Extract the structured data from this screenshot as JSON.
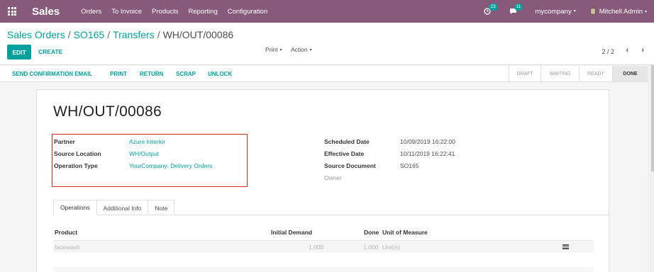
{
  "navbar": {
    "app_name": "Sales",
    "menu": [
      "Orders",
      "To Invoice",
      "Products",
      "Reporting",
      "Configuration"
    ],
    "activity_count": "23",
    "message_count": "11",
    "company": "mycompany",
    "user": "Mitchell Admin"
  },
  "breadcrumb": {
    "items": [
      "Sales Orders",
      "SO165",
      "Transfers"
    ],
    "separator": "/",
    "current": "WH/OUT/00086"
  },
  "toolbar": {
    "edit_label": "EDIT",
    "create_label": "CREATE",
    "print_label": "Print",
    "action_label": "Action",
    "pager": "2 / 2",
    "prev_glyph": "‹",
    "next_glyph": "›",
    "caret_glyph": "▾"
  },
  "header_buttons": [
    "SEND CONFIRMATION EMAIL",
    "PRINT",
    "RETURN",
    "SCRAP",
    "UNLOCK"
  ],
  "stages": [
    {
      "label": "DRAFT",
      "current": false
    },
    {
      "label": "WAITING",
      "current": false
    },
    {
      "label": "READY",
      "current": false
    },
    {
      "label": "DONE",
      "current": true
    }
  ],
  "record": {
    "name": "WH/OUT/00086",
    "left_fields": [
      {
        "label": "Partner",
        "value": "Azure Interior"
      },
      {
        "label": "Source Location",
        "value": "WH/Output"
      },
      {
        "label": "Operation Type",
        "value": "YourCompany: Delivery Orders"
      }
    ],
    "right_fields": [
      {
        "label": "Scheduled Date",
        "value": "10/09/2019 16:22:00"
      },
      {
        "label": "Effective Date",
        "value": "10/11/2019 16:22:41"
      },
      {
        "label": "Source Document",
        "value": "SO165"
      },
      {
        "label": "Owner",
        "value": ""
      }
    ]
  },
  "notebook": {
    "tabs": [
      "Operations",
      "Additional Info",
      "Note"
    ],
    "active_tab": "Operations"
  },
  "operations_table": {
    "columns": [
      "Product",
      "Initial Demand",
      "Done",
      "Unit of Measure"
    ],
    "rows": [
      {
        "product": "facewash",
        "initial_demand": "1.000",
        "done": "1.000",
        "uom": "Unit(s)"
      }
    ]
  },
  "colors": {
    "navbar": "#875a7b",
    "accent": "#00a09d",
    "highlight_border": "#d9271e"
  },
  "icons": {
    "apps": "apps-grid-icon",
    "activity": "clock-icon",
    "messages": "chat-bubble-icon",
    "row_detail": "list-icon"
  }
}
